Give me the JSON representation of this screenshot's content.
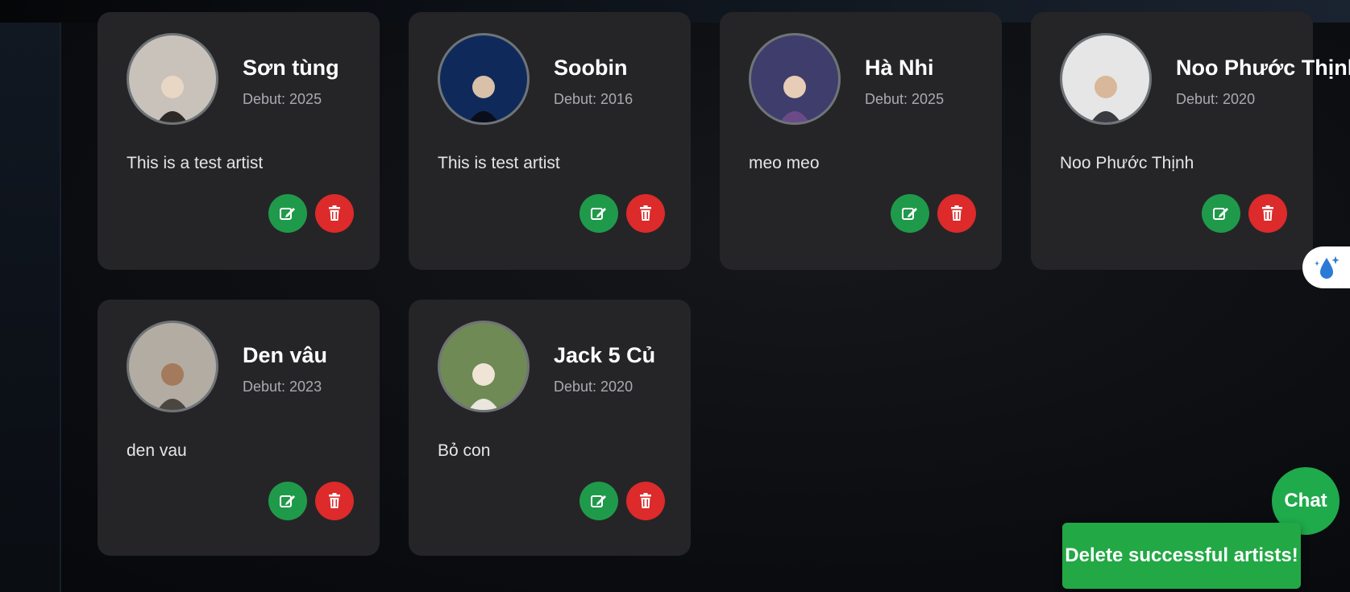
{
  "artists": [
    {
      "name": "Sơn tùng",
      "debut_label": "Debut: 2025",
      "description": "This is a test artist",
      "avatar_icon": "artist-photo-icon",
      "avatar_bg": "#c9c2bb",
      "accent": "#2d2926"
    },
    {
      "name": "Soobin",
      "debut_label": "Debut: 2016",
      "description": "This is test artist",
      "avatar_icon": "artist-photo-icon",
      "avatar_bg": "#0f2a5a",
      "accent": "#0a0d1a"
    },
    {
      "name": "Hà Nhi",
      "debut_label": "Debut: 2025",
      "description": "meo meo",
      "avatar_icon": "artist-photo-icon",
      "avatar_bg": "#3f3d6b",
      "accent": "#6a4b88"
    },
    {
      "name": "Noo Phước Thịnh",
      "debut_label": "Debut: 2020",
      "description": "Noo Phước Thịnh",
      "avatar_icon": "artist-photo-icon",
      "avatar_bg": "#e6e6e6",
      "accent": "#3a3a40"
    },
    {
      "name": "Den vâu",
      "debut_label": "Debut: 2023",
      "description": "den vau",
      "avatar_icon": "artist-photo-icon",
      "avatar_bg": "#b3aca3",
      "accent": "#4b4640"
    },
    {
      "name": "Jack 5 Củ",
      "debut_label": "Debut: 2020",
      "description": "Bỏ con",
      "avatar_icon": "artist-photo-icon",
      "avatar_bg": "#6f8a54",
      "accent": "#e9e6dd"
    }
  ],
  "actions": {
    "edit_icon": "edit-icon",
    "delete_icon": "trash-icon"
  },
  "chat": {
    "label": "Chat"
  },
  "toast": {
    "message": "Delete successful artists!"
  },
  "side_widget": {
    "icon": "sparkle-drop-icon"
  },
  "colors": {
    "edit": "#1f9a4a",
    "delete": "#dd2a2a",
    "toast": "#22a845",
    "card": "#252527"
  }
}
